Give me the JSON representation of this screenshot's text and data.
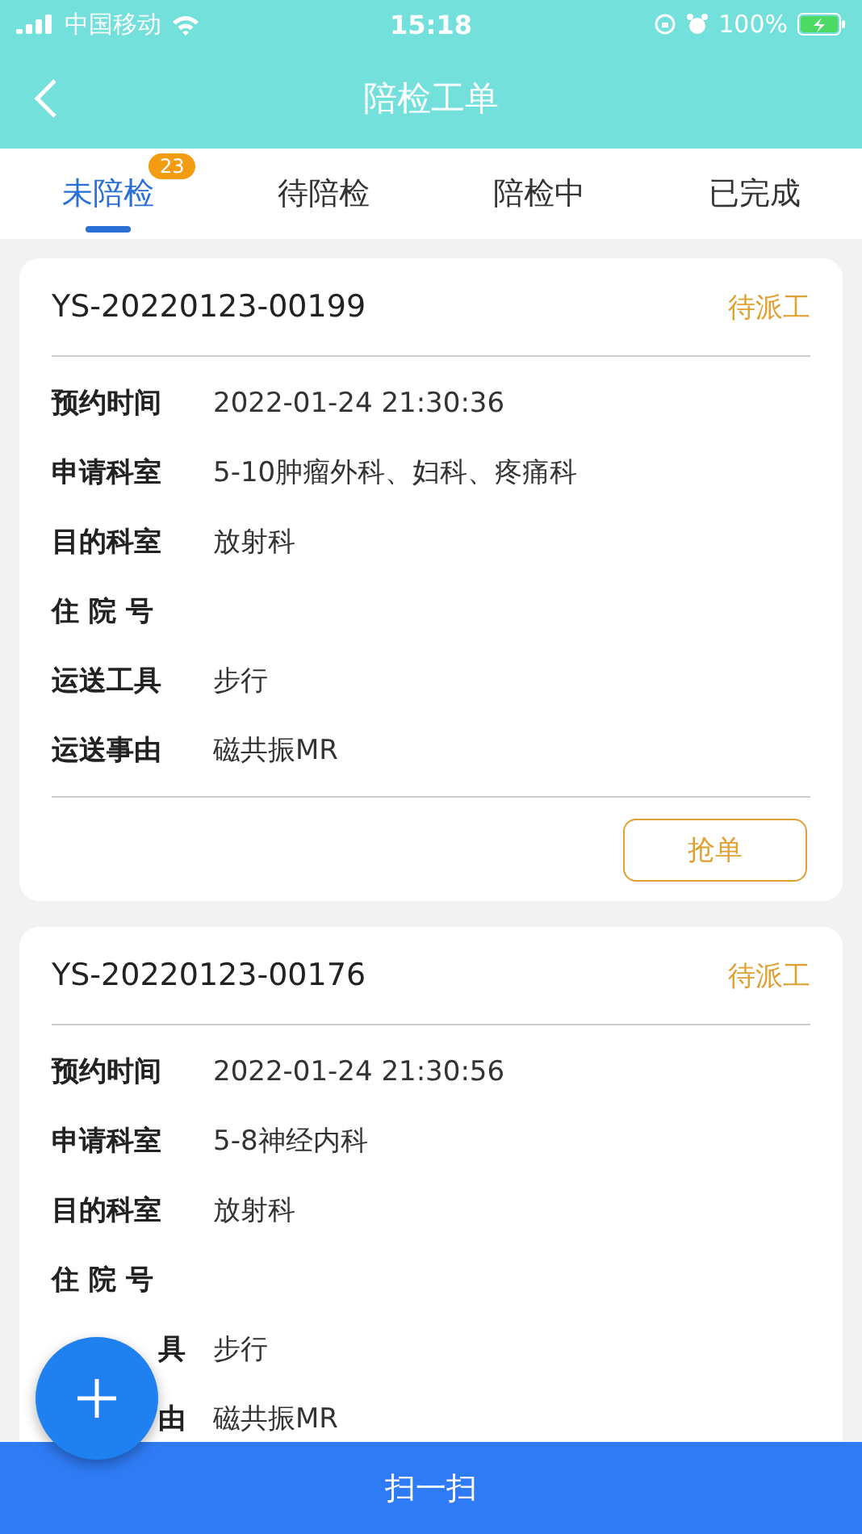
{
  "status_bar": {
    "carrier": "中国移动",
    "time": "15:18",
    "battery": "100%"
  },
  "nav": {
    "title": "陪检工单"
  },
  "tabs": [
    {
      "label": "未陪检",
      "selected": true,
      "badge": "23"
    },
    {
      "label": "待陪检",
      "selected": false
    },
    {
      "label": "陪检中",
      "selected": false
    },
    {
      "label": "已完成",
      "selected": false
    }
  ],
  "orders": [
    {
      "id": "YS-20220123-00199",
      "status": "待派工",
      "fields": [
        {
          "label": "预约时间",
          "value": "2022-01-24 21:30:36"
        },
        {
          "label": "申请科室",
          "value": "5-10肿瘤外科、妇科、疼痛科"
        },
        {
          "label": "目的科室",
          "value": "放射科"
        },
        {
          "label": "住 院 号"
        },
        {
          "label": "运送工具",
          "value": "步行"
        },
        {
          "label": "运送事由",
          "value": "磁共振MR"
        }
      ],
      "action": "抢单"
    },
    {
      "id": "YS-20220123-00176",
      "status": "待派工",
      "fields": [
        {
          "label": "预约时间",
          "value": "2022-01-24 21:30:56"
        },
        {
          "label": "申请科室",
          "value": "5-8神经内科"
        },
        {
          "label": "目的科室",
          "value": "放射科"
        },
        {
          "label": "住 院 号"
        },
        {
          "label": "具",
          "covered": true,
          "value": "步行"
        },
        {
          "label": "由",
          "covered": true,
          "value": "磁共振MR"
        }
      ]
    }
  ],
  "bottom_button": "扫一扫"
}
